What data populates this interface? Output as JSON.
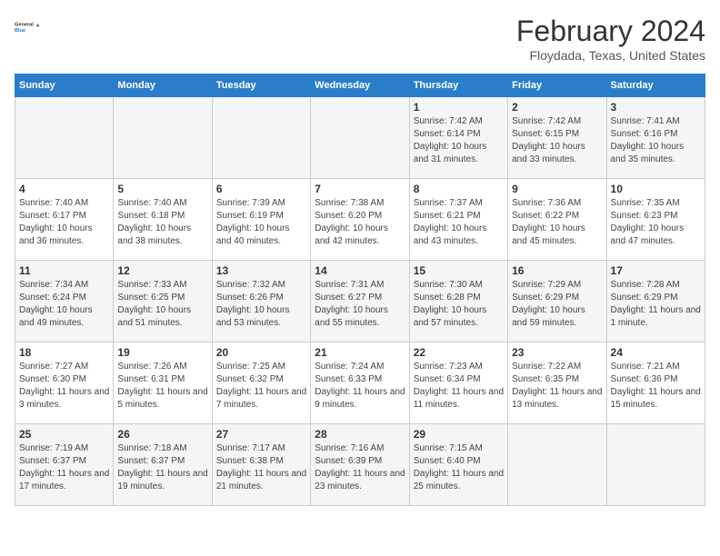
{
  "header": {
    "logo_line1": "General",
    "logo_line2": "Blue",
    "month_year": "February 2024",
    "location": "Floydada, Texas, United States"
  },
  "weekdays": [
    "Sunday",
    "Monday",
    "Tuesday",
    "Wednesday",
    "Thursday",
    "Friday",
    "Saturday"
  ],
  "weeks": [
    [
      {
        "day": "",
        "info": ""
      },
      {
        "day": "",
        "info": ""
      },
      {
        "day": "",
        "info": ""
      },
      {
        "day": "",
        "info": ""
      },
      {
        "day": "1",
        "info": "Sunrise: 7:42 AM\nSunset: 6:14 PM\nDaylight: 10 hours and 31 minutes."
      },
      {
        "day": "2",
        "info": "Sunrise: 7:42 AM\nSunset: 6:15 PM\nDaylight: 10 hours and 33 minutes."
      },
      {
        "day": "3",
        "info": "Sunrise: 7:41 AM\nSunset: 6:16 PM\nDaylight: 10 hours and 35 minutes."
      }
    ],
    [
      {
        "day": "4",
        "info": "Sunrise: 7:40 AM\nSunset: 6:17 PM\nDaylight: 10 hours and 36 minutes."
      },
      {
        "day": "5",
        "info": "Sunrise: 7:40 AM\nSunset: 6:18 PM\nDaylight: 10 hours and 38 minutes."
      },
      {
        "day": "6",
        "info": "Sunrise: 7:39 AM\nSunset: 6:19 PM\nDaylight: 10 hours and 40 minutes."
      },
      {
        "day": "7",
        "info": "Sunrise: 7:38 AM\nSunset: 6:20 PM\nDaylight: 10 hours and 42 minutes."
      },
      {
        "day": "8",
        "info": "Sunrise: 7:37 AM\nSunset: 6:21 PM\nDaylight: 10 hours and 43 minutes."
      },
      {
        "day": "9",
        "info": "Sunrise: 7:36 AM\nSunset: 6:22 PM\nDaylight: 10 hours and 45 minutes."
      },
      {
        "day": "10",
        "info": "Sunrise: 7:35 AM\nSunset: 6:23 PM\nDaylight: 10 hours and 47 minutes."
      }
    ],
    [
      {
        "day": "11",
        "info": "Sunrise: 7:34 AM\nSunset: 6:24 PM\nDaylight: 10 hours and 49 minutes."
      },
      {
        "day": "12",
        "info": "Sunrise: 7:33 AM\nSunset: 6:25 PM\nDaylight: 10 hours and 51 minutes."
      },
      {
        "day": "13",
        "info": "Sunrise: 7:32 AM\nSunset: 6:26 PM\nDaylight: 10 hours and 53 minutes."
      },
      {
        "day": "14",
        "info": "Sunrise: 7:31 AM\nSunset: 6:27 PM\nDaylight: 10 hours and 55 minutes."
      },
      {
        "day": "15",
        "info": "Sunrise: 7:30 AM\nSunset: 6:28 PM\nDaylight: 10 hours and 57 minutes."
      },
      {
        "day": "16",
        "info": "Sunrise: 7:29 AM\nSunset: 6:29 PM\nDaylight: 10 hours and 59 minutes."
      },
      {
        "day": "17",
        "info": "Sunrise: 7:28 AM\nSunset: 6:29 PM\nDaylight: 11 hours and 1 minute."
      }
    ],
    [
      {
        "day": "18",
        "info": "Sunrise: 7:27 AM\nSunset: 6:30 PM\nDaylight: 11 hours and 3 minutes."
      },
      {
        "day": "19",
        "info": "Sunrise: 7:26 AM\nSunset: 6:31 PM\nDaylight: 11 hours and 5 minutes."
      },
      {
        "day": "20",
        "info": "Sunrise: 7:25 AM\nSunset: 6:32 PM\nDaylight: 11 hours and 7 minutes."
      },
      {
        "day": "21",
        "info": "Sunrise: 7:24 AM\nSunset: 6:33 PM\nDaylight: 11 hours and 9 minutes."
      },
      {
        "day": "22",
        "info": "Sunrise: 7:23 AM\nSunset: 6:34 PM\nDaylight: 11 hours and 11 minutes."
      },
      {
        "day": "23",
        "info": "Sunrise: 7:22 AM\nSunset: 6:35 PM\nDaylight: 11 hours and 13 minutes."
      },
      {
        "day": "24",
        "info": "Sunrise: 7:21 AM\nSunset: 6:36 PM\nDaylight: 11 hours and 15 minutes."
      }
    ],
    [
      {
        "day": "25",
        "info": "Sunrise: 7:19 AM\nSunset: 6:37 PM\nDaylight: 11 hours and 17 minutes."
      },
      {
        "day": "26",
        "info": "Sunrise: 7:18 AM\nSunset: 6:37 PM\nDaylight: 11 hours and 19 minutes."
      },
      {
        "day": "27",
        "info": "Sunrise: 7:17 AM\nSunset: 6:38 PM\nDaylight: 11 hours and 21 minutes."
      },
      {
        "day": "28",
        "info": "Sunrise: 7:16 AM\nSunset: 6:39 PM\nDaylight: 11 hours and 23 minutes."
      },
      {
        "day": "29",
        "info": "Sunrise: 7:15 AM\nSunset: 6:40 PM\nDaylight: 11 hours and 25 minutes."
      },
      {
        "day": "",
        "info": ""
      },
      {
        "day": "",
        "info": ""
      }
    ]
  ]
}
